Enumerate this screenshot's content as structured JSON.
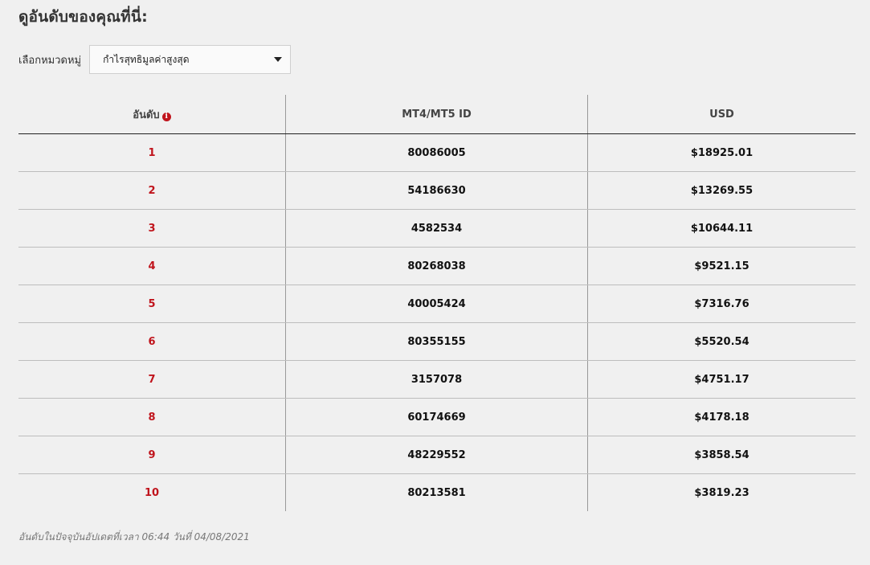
{
  "heading": "ดูอันดับของคุณที่นี่:",
  "category": {
    "label": "เลือกหมวดหมู่",
    "selected": "กำไรสุทธิมูลค่าสูงสุด"
  },
  "table": {
    "headers": {
      "rank": "อันดับ",
      "id": "MT4/MT5 ID",
      "usd": "USD"
    },
    "rows": [
      {
        "rank": "1",
        "id": "80086005",
        "usd": "$18925.01"
      },
      {
        "rank": "2",
        "id": "54186630",
        "usd": "$13269.55"
      },
      {
        "rank": "3",
        "id": "4582534",
        "usd": "$10644.11"
      },
      {
        "rank": "4",
        "id": "80268038",
        "usd": "$9521.15"
      },
      {
        "rank": "5",
        "id": "40005424",
        "usd": "$7316.76"
      },
      {
        "rank": "6",
        "id": "80355155",
        "usd": "$5520.54"
      },
      {
        "rank": "7",
        "id": "3157078",
        "usd": "$4751.17"
      },
      {
        "rank": "8",
        "id": "60174669",
        "usd": "$4178.18"
      },
      {
        "rank": "9",
        "id": "48229552",
        "usd": "$3858.54"
      },
      {
        "rank": "10",
        "id": "80213581",
        "usd": "$3819.23"
      }
    ]
  },
  "footer_note": "อันดับในปัจจุบันอัปเดตที่เวลา 06:44 วันที่ 04/08/2021",
  "icons": {
    "info": "info-icon"
  },
  "colors": {
    "accent": "#c0141c",
    "background": "#f0f0f0"
  }
}
